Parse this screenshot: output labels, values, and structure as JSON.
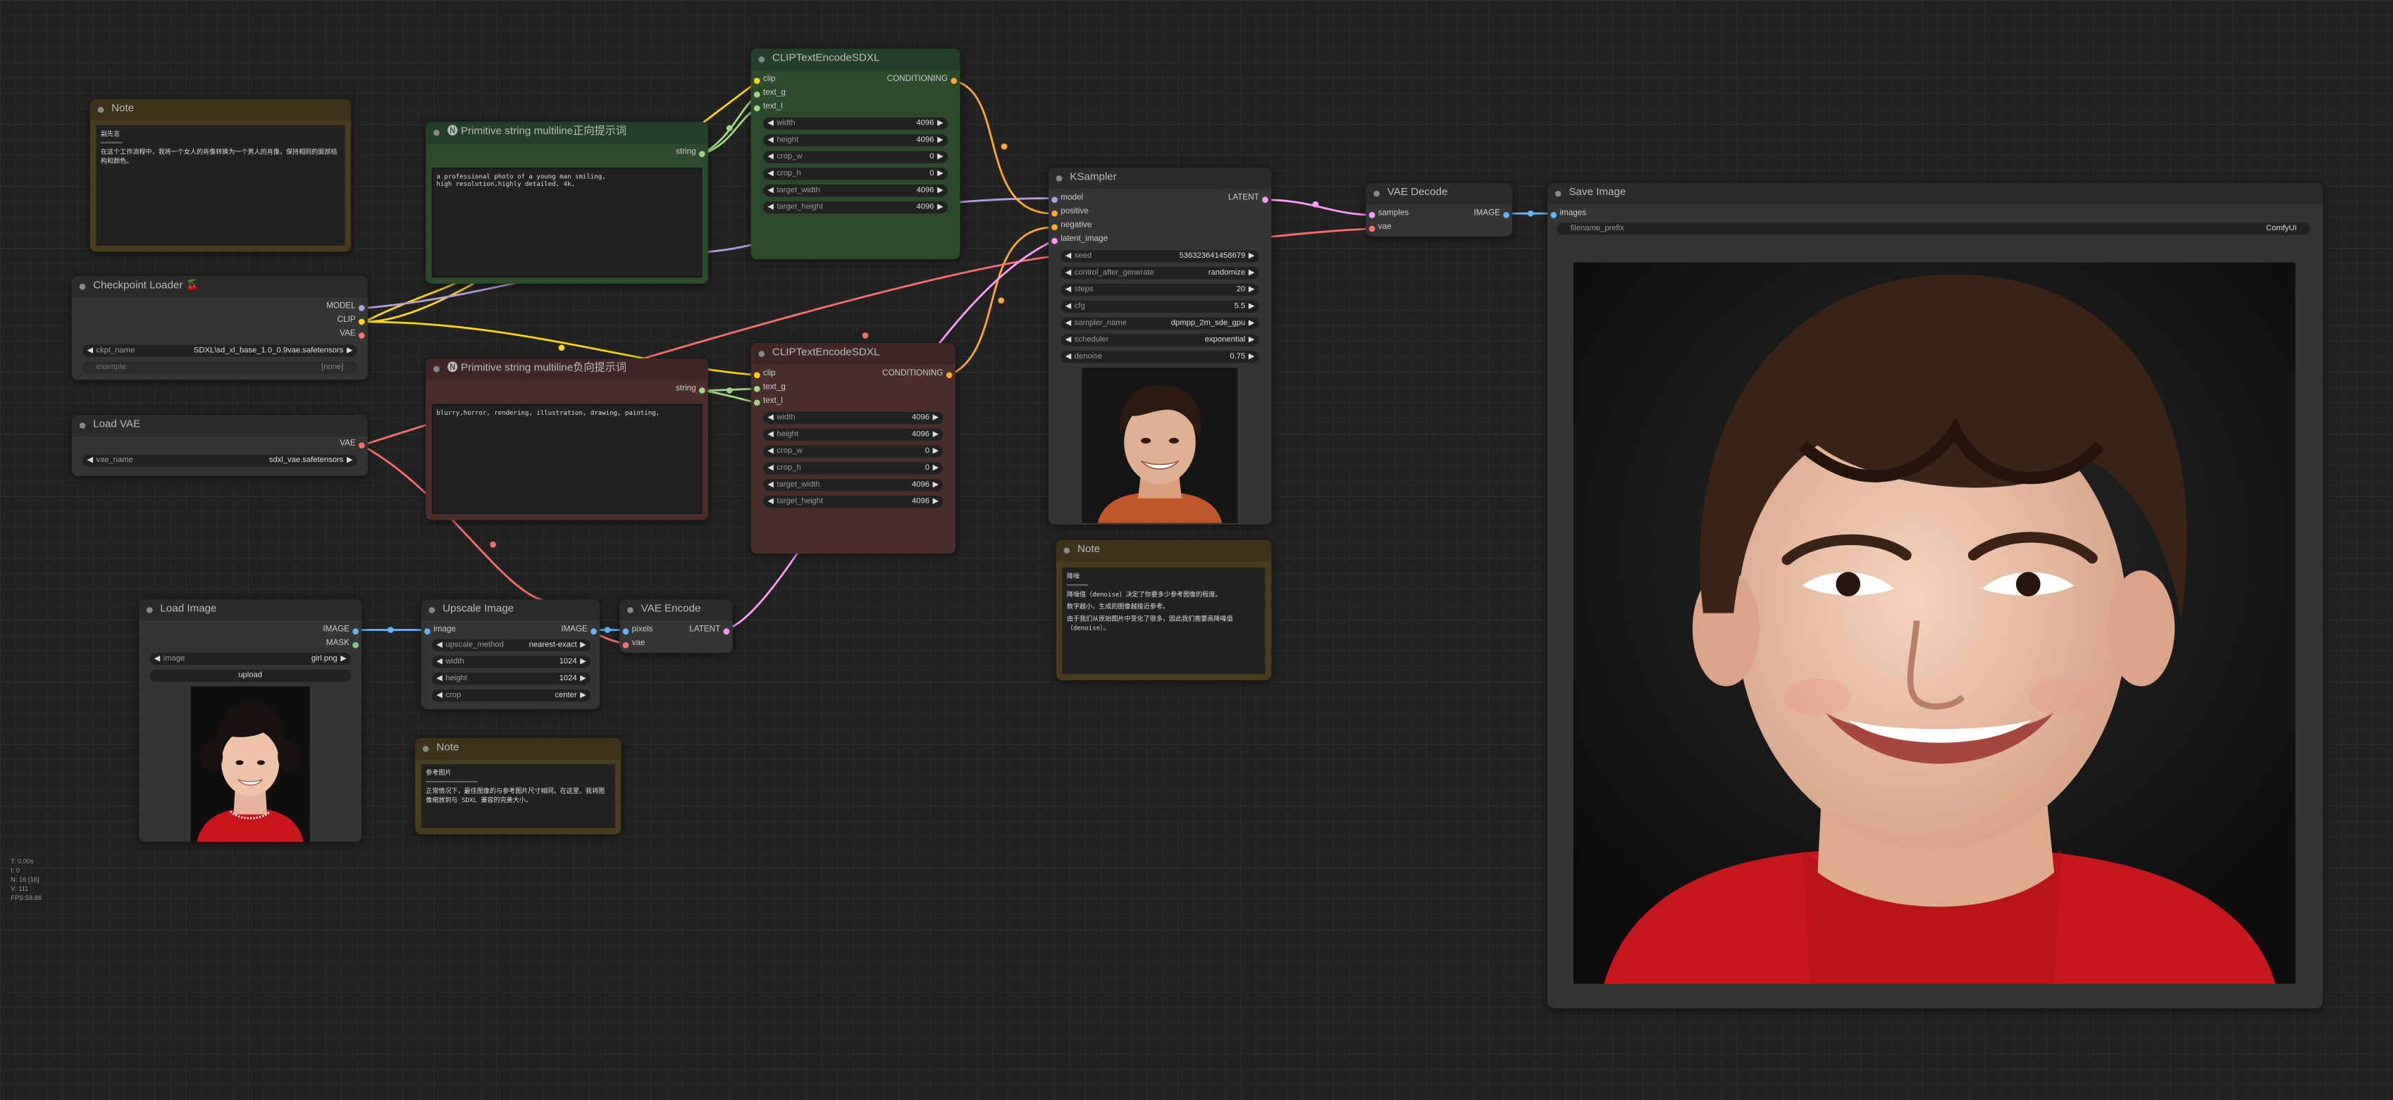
{
  "colors": {
    "clip": "#ffd500",
    "model": "#b39ddb",
    "vae": "#ff6e6e",
    "image": "#64b5f6",
    "latent": "#ff9cf9",
    "conditioning": "#ffa931",
    "string": "#a1d682",
    "positive_bg": "#2d4a2d",
    "negative_bg": "#4a2e2e",
    "note_bg": "#4a3c1e"
  },
  "note1": {
    "title": "Note",
    "heading": "副先言",
    "text": "在这个工作流程中，我将一个女人的肖像转换为一个男人的肖像，保持相同的面部结构和颜色。"
  },
  "checkpoint_loader": {
    "title": "Checkpoint Loader 🍒",
    "outputs": [
      "MODEL",
      "CLIP",
      "VAE"
    ],
    "ckpt_label": "ckpt_name",
    "ckpt_value": "SDXL\\sd_xl_base_1.0_0.9vae.safetensors",
    "example_label": "example",
    "example_value": "[none]"
  },
  "load_vae": {
    "title": "Load VAE",
    "output": "VAE",
    "vae_label": "vae_name",
    "vae_value": "sdxl_vae.safetensors"
  },
  "positive_prompt": {
    "title": "🅝 Primitive string multiline正向提示词",
    "output": "string",
    "text": "a professional photo of a young man smiling,\nhigh resolution,highly detailed, 4k,"
  },
  "negative_prompt": {
    "title": "🅝 Primitive string multiline负向提示词",
    "output": "string",
    "text": "blurry,horror, rendering, illustration, drawing, painting,"
  },
  "clip_encode_pos": {
    "title": "CLIPTextEncodeSDXL",
    "inputs": [
      "clip",
      "text_g",
      "text_l"
    ],
    "output": "CONDITIONING",
    "widgets": [
      {
        "label": "width",
        "value": "4096"
      },
      {
        "label": "height",
        "value": "4096"
      },
      {
        "label": "crop_w",
        "value": "0"
      },
      {
        "label": "crop_h",
        "value": "0"
      },
      {
        "label": "target_width",
        "value": "4096"
      },
      {
        "label": "target_height",
        "value": "4096"
      }
    ]
  },
  "clip_encode_neg": {
    "title": "CLIPTextEncodeSDXL",
    "inputs": [
      "clip",
      "text_g",
      "text_l"
    ],
    "output": "CONDITIONING",
    "widgets": [
      {
        "label": "width",
        "value": "4096"
      },
      {
        "label": "height",
        "value": "4096"
      },
      {
        "label": "crop_w",
        "value": "0"
      },
      {
        "label": "crop_h",
        "value": "0"
      },
      {
        "label": "target_width",
        "value": "4096"
      },
      {
        "label": "target_height",
        "value": "4096"
      }
    ]
  },
  "ksampler": {
    "title": "KSampler",
    "inputs": [
      "model",
      "positive",
      "negative",
      "latent_image"
    ],
    "output": "LATENT",
    "widgets": [
      {
        "label": "seed",
        "value": "536323641458679"
      },
      {
        "label": "control_after_generate",
        "value": "randomize"
      },
      {
        "label": "steps",
        "value": "20"
      },
      {
        "label": "cfg",
        "value": "5.5"
      },
      {
        "label": "sampler_name",
        "value": "dpmpp_2m_sde_gpu"
      },
      {
        "label": "scheduler",
        "value": "exponential"
      },
      {
        "label": "denoise",
        "value": "0.75"
      }
    ]
  },
  "vae_decode": {
    "title": "VAE Decode",
    "inputs": [
      "samples",
      "vae"
    ],
    "output": "IMAGE"
  },
  "save_image": {
    "title": "Save Image",
    "input": "images",
    "prefix_label": "filename_prefix",
    "prefix_value": "ComfyUI"
  },
  "note2": {
    "title": "Note",
    "heading": "降噪",
    "lines": [
      "降噪值（denoise）决定了你要多少参考图像的程度。",
      "数字越小，生成的图像越接近参考。",
      "由于我们从原始图片中变化了很多，因此我们需要高降噪值（denoise）。"
    ]
  },
  "load_image": {
    "title": "Load Image",
    "outputs": [
      "IMAGE",
      "MASK"
    ],
    "image_label": "image",
    "image_value": "girl.png",
    "upload_label": "upload"
  },
  "upscale_image": {
    "title": "Upscale Image",
    "input": "image",
    "output": "IMAGE",
    "widgets": [
      {
        "label": "upscale_method",
        "value": "nearest-exact"
      },
      {
        "label": "width",
        "value": "1024"
      },
      {
        "label": "height",
        "value": "1024"
      },
      {
        "label": "crop",
        "value": "center"
      }
    ]
  },
  "vae_encode": {
    "title": "VAE Encode",
    "inputs": [
      "pixels",
      "vae"
    ],
    "output": "LATENT"
  },
  "note3": {
    "title": "Note",
    "heading": "参考图片",
    "text": "正常情况下，最佳图像的与参考图片尺寸相同。在这里，我将图像缩放到与 SDXL 兼容的完美大小。"
  },
  "stats": [
    "T: 0.00s",
    "I: 0",
    "N: 16 [16]",
    "V: 111",
    "FPS:59.88"
  ]
}
